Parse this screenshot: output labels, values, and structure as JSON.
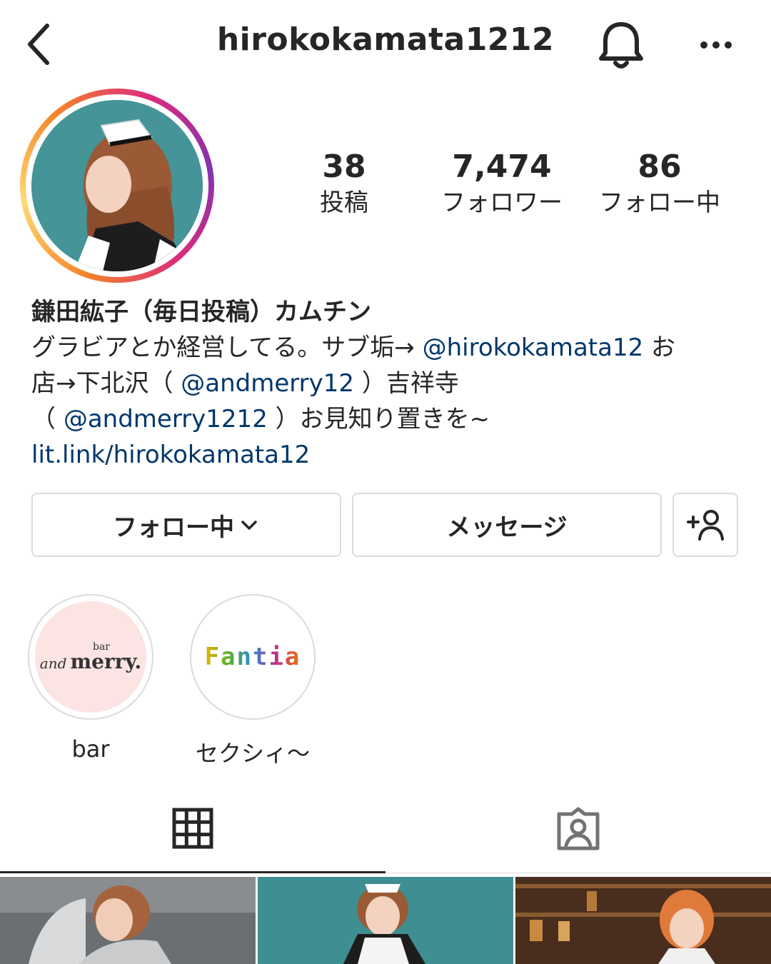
{
  "header": {
    "username": "hirokokamata1212",
    "back_icon": "chevron-left-icon",
    "bell_icon": "bell-icon",
    "more_icon": "more-horizontal-icon"
  },
  "profile": {
    "avatar_icon": "profile-avatar",
    "ring_colors": [
      "#f58529",
      "#dd2a7b",
      "#8134af"
    ]
  },
  "stats": [
    {
      "value": "38",
      "label": "投稿"
    },
    {
      "value": "7,474",
      "label": "フォロワー"
    },
    {
      "value": "86",
      "label": "フォロー中"
    }
  ],
  "bio": {
    "name": "鎌田紘子（毎日投稿）カムチン",
    "line1_a": "グラビアとか経営してる。サブ垢→ ",
    "mention1": "@hirokokamata12",
    "line1_b": " お",
    "line2_a": "店→下北沢（ ",
    "mention2": "@andmerry12",
    "line2_b": " ）吉祥寺",
    "line3_a": "（ ",
    "mention3": "@andmerry1212",
    "line3_b": " ）お見知り置きを~",
    "link": "lit.link/hirokokamata12",
    "link_color": "#00376b"
  },
  "actions": {
    "follow_label": "フォロー中",
    "message_label": "メッセージ",
    "add_user_icon": "add-user-icon"
  },
  "highlights": [
    {
      "label": "bar",
      "logo_small": "bar",
      "logo_a": "and",
      "logo_b": "merry."
    },
    {
      "label": "セクシィ～",
      "logo": "Fantia"
    }
  ],
  "tabs": [
    {
      "icon": "grid-icon",
      "active": true
    },
    {
      "icon": "tagged-icon",
      "active": false
    }
  ]
}
